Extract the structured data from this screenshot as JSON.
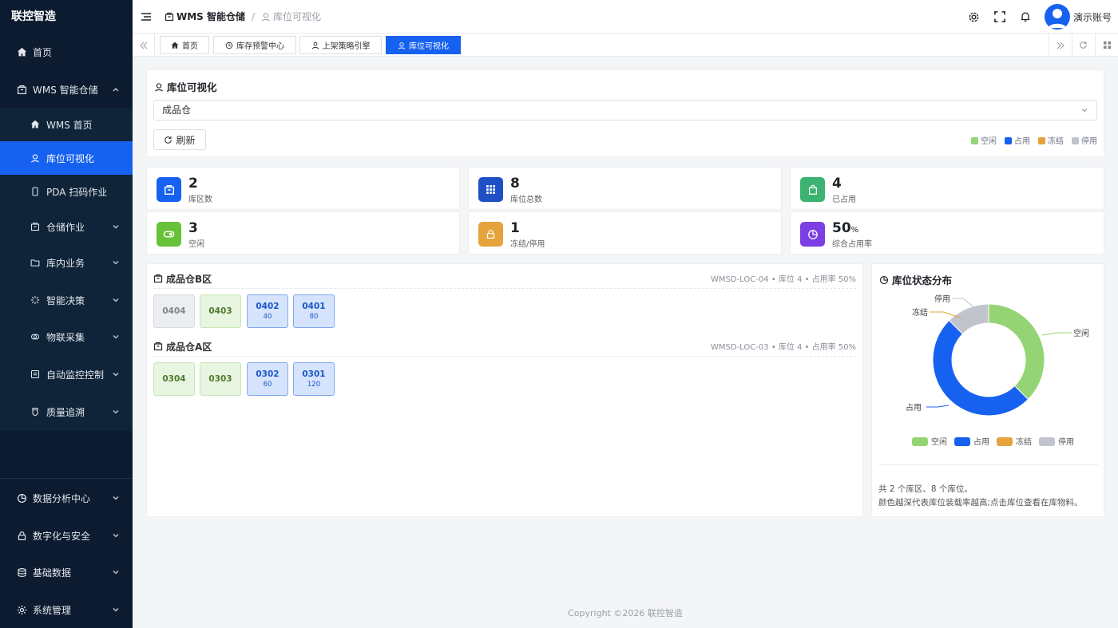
{
  "app": {
    "title": "联控智造"
  },
  "sidebar": {
    "items": [
      {
        "label": "首页"
      },
      {
        "label": "WMS 智能仓储"
      },
      {
        "label": "WMS 首页"
      },
      {
        "label": "库位可视化"
      },
      {
        "label": "PDA 扫码作业"
      },
      {
        "label": "仓储作业"
      },
      {
        "label": "库内业务"
      },
      {
        "label": "智能决策"
      },
      {
        "label": "物联采集"
      },
      {
        "label": "自动监控控制"
      },
      {
        "label": "质量追溯"
      },
      {
        "label": "数据分析中心"
      },
      {
        "label": "数字化与安全"
      },
      {
        "label": "基础数据"
      },
      {
        "label": "系统管理"
      }
    ]
  },
  "header": {
    "breadcrumb_1": "WMS 智能仓储",
    "breadcrumb_sep": "/",
    "breadcrumb_2": "库位可视化",
    "user": "演示账号"
  },
  "tabs": [
    {
      "label": "首页"
    },
    {
      "label": "库存预警中心"
    },
    {
      "label": "上架策略引擎"
    },
    {
      "label": "库位可视化"
    }
  ],
  "panel": {
    "title": "库位可视化",
    "warehouse": "成品仓",
    "refresh": "刷新",
    "legend": [
      "空闲",
      "占用",
      "冻结",
      "停用"
    ]
  },
  "colors": {
    "idle": "#95d475",
    "occupied": "#1661f0",
    "frozen": "#e6a23c",
    "disabled": "#c0c4cc",
    "accent": "#1661f0"
  },
  "stats": [
    {
      "value": "2",
      "label": "库区数"
    },
    {
      "value": "8",
      "label": "库位总数"
    },
    {
      "value": "4",
      "label": "已占用"
    },
    {
      "value": "3",
      "label": "空闲"
    },
    {
      "value": "1",
      "label": "冻结/停用"
    },
    {
      "value": "50",
      "unit": "%",
      "label": "综合占用率"
    }
  ],
  "zones": [
    {
      "name": "成品仓B区",
      "info": "WMSD-LOC-04 • 库位 4 • 占用率 50%",
      "locations": [
        {
          "code": "0404",
          "qty": "",
          "status": "stop"
        },
        {
          "code": "0403",
          "qty": "",
          "status": "idle"
        },
        {
          "code": "0402",
          "qty": "40",
          "status": "occ"
        },
        {
          "code": "0401",
          "qty": "80",
          "status": "occ"
        }
      ]
    },
    {
      "name": "成品仓A区",
      "info": "WMSD-LOC-03 • 库位 4 • 占用率 50%",
      "locations": [
        {
          "code": "0304",
          "qty": "",
          "status": "idle"
        },
        {
          "code": "0303",
          "qty": "",
          "status": "idle"
        },
        {
          "code": "0302",
          "qty": "60",
          "status": "occ"
        },
        {
          "code": "0301",
          "qty": "120",
          "status": "occ"
        }
      ]
    }
  ],
  "distribution": {
    "title": "库位状态分布",
    "summary_1": "共 2 个库区、8 个库位。",
    "summary_2": "颜色越深代表库位装载率越高;点击库位查看在库物料。"
  },
  "chart_data": {
    "type": "pie",
    "categories": [
      "空闲",
      "占用",
      "冻结",
      "停用"
    ],
    "values": [
      3,
      4,
      0,
      1
    ],
    "colors": [
      "#95d475",
      "#1661f0",
      "#e6a23c",
      "#c0c4cc"
    ],
    "legend": "bottom"
  },
  "footer": {
    "copyright": "Copyright ©2026 联控智造"
  }
}
